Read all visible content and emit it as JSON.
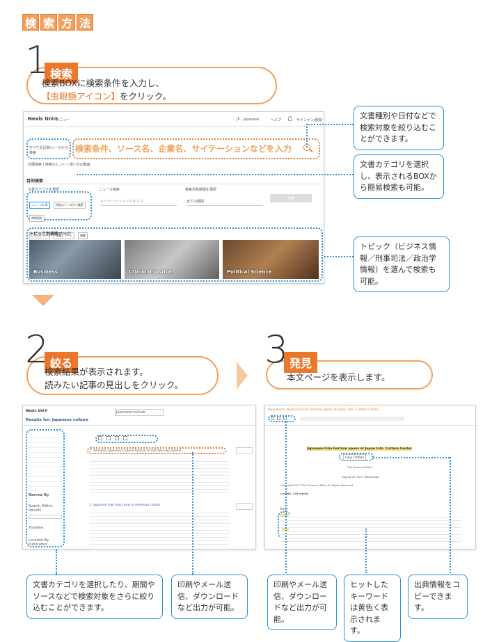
{
  "title": [
    "検",
    "索",
    "方",
    "法"
  ],
  "step1": {
    "num": "1",
    "badge": "検索",
    "line1": "検索BOXに検索条件を入力し、",
    "line2_highlight": "【虫眼鏡アイコン】",
    "line2_rest": "をクリック。"
  },
  "nexis": {
    "logo": "Nexis Uni®",
    "menu": "メニュー",
    "lang": "JP - Japanese",
    "help": "ヘルプ",
    "signin": "サインイン/登録",
    "search_scope": "すべての記事/ソースから検索",
    "search_placeholder": "検索条件、ソース名、企業名、サイテーションなどを入力",
    "search_links": "詳細検索 | 検索のヒント | 使い方の動画",
    "guided_title": "目的検索",
    "cat_label": "文書カテゴリを選択",
    "cat_buttons": [
      "ニュース記事",
      "特定のソースから検索",
      "判例研究",
      "ローレビュー",
      "企業レポート",
      "新聞"
    ],
    "news_label": "ニュース検索",
    "news_placeholder": "キーワード/トピックを入力",
    "period_label": "検索対象期間を選択",
    "period_value": "全ての期間",
    "search_btn": "検索",
    "topics_title": "トピック別検索ページ",
    "topics": [
      "Business",
      "Criminal Justice",
      "Political Science"
    ]
  },
  "callouts": {
    "c1": "文書種別や日付などで検索対象を絞り込むことができます。",
    "c2": "文書カテゴリを選択し、表示されるBOXから簡易検索も可能。",
    "c3": "トピック（ビジネス情報／刑事司法／政治学情報）を選んで検索も可能。",
    "c4": "文書カテゴリを選択したり、期間やソースなどで検索対象をさらに絞り込むことができます。",
    "c5": "印刷やメール送信、ダウンロードなど出力が可能。",
    "c6": "印刷やメール送信、ダウンロードなど出力が可能。",
    "c7": "ヒットしたキーワードは黄色く表示されます。",
    "c8": "出典情報をコピーできます。"
  },
  "step2": {
    "num": "2",
    "badge": "絞る",
    "line1": "検索結果が表示されます。",
    "line2": "読みたい記事の見出しをクリック。",
    "results_title": "Results for: Japanese culture",
    "search_value": "Japanese culture",
    "filters": [
      "Narrow By",
      "Search Within Results",
      "Timeline",
      "Location By Publication"
    ],
    "result1": "1. Kamome, Japanese Cultural Festival to hold two-day festival",
    "result2": "2. Japanese food may come to American culture"
  },
  "step3": {
    "num": "3",
    "badge": "発見",
    "line1": "本文ページを表示します。",
    "doc_title": "Document: Japanese Film Festival opens at Japan Info. Culture Center",
    "article_headline": "Japanese Film Festival opens at Japan Info. Culture Center",
    "copy_cite": "Copy Citation",
    "paper": "The Financial Daily",
    "date": "August 25, 2017 Wednesday",
    "copyright": "Copyright 2017 The Financial Daily All Rights Reserved",
    "length": "Length: 235 words",
    "body_label": "Body"
  },
  "colors": {
    "accent": "#e9782a",
    "blue": "#2a8fd8"
  }
}
